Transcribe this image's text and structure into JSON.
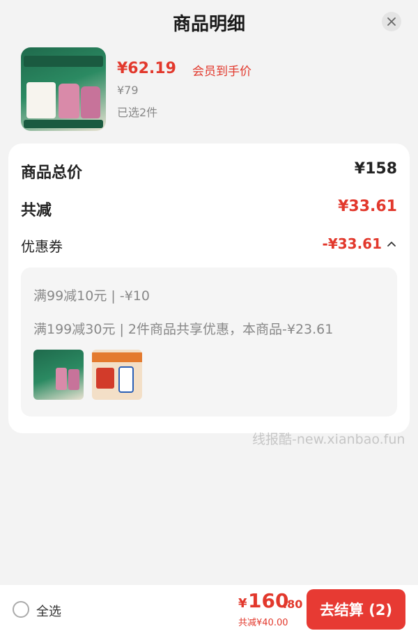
{
  "header": {
    "title": "商品明细"
  },
  "product": {
    "price": "¥62.19",
    "price_tag": "会员到手价",
    "original_price": "¥79",
    "selected_count": "已选2件"
  },
  "summary": {
    "total_label": "商品总价",
    "total_value": "¥158",
    "reduce_label": "共减",
    "reduce_value": "¥33.61",
    "coupon_label": "优惠券",
    "coupon_value": "-¥33.61"
  },
  "coupon_details": {
    "line1": "满99减10元 | -¥10",
    "line2": "满199减30元 | 2件商品共享优惠，本商品-¥23.61"
  },
  "watermark": "线报酷-new.xianbao.fun",
  "bottom_bar": {
    "select_all": "全选",
    "currency": "¥",
    "final_int": "160",
    "final_dec": ".80",
    "final_reduce": "共减¥40.00",
    "checkout": "去结算 (2)"
  },
  "colors": {
    "accent": "#e2382c",
    "checkout_button": "#e73a33",
    "background": "#f3f3f3"
  },
  "icons": [
    "close-icon",
    "chevron-up-icon"
  ]
}
